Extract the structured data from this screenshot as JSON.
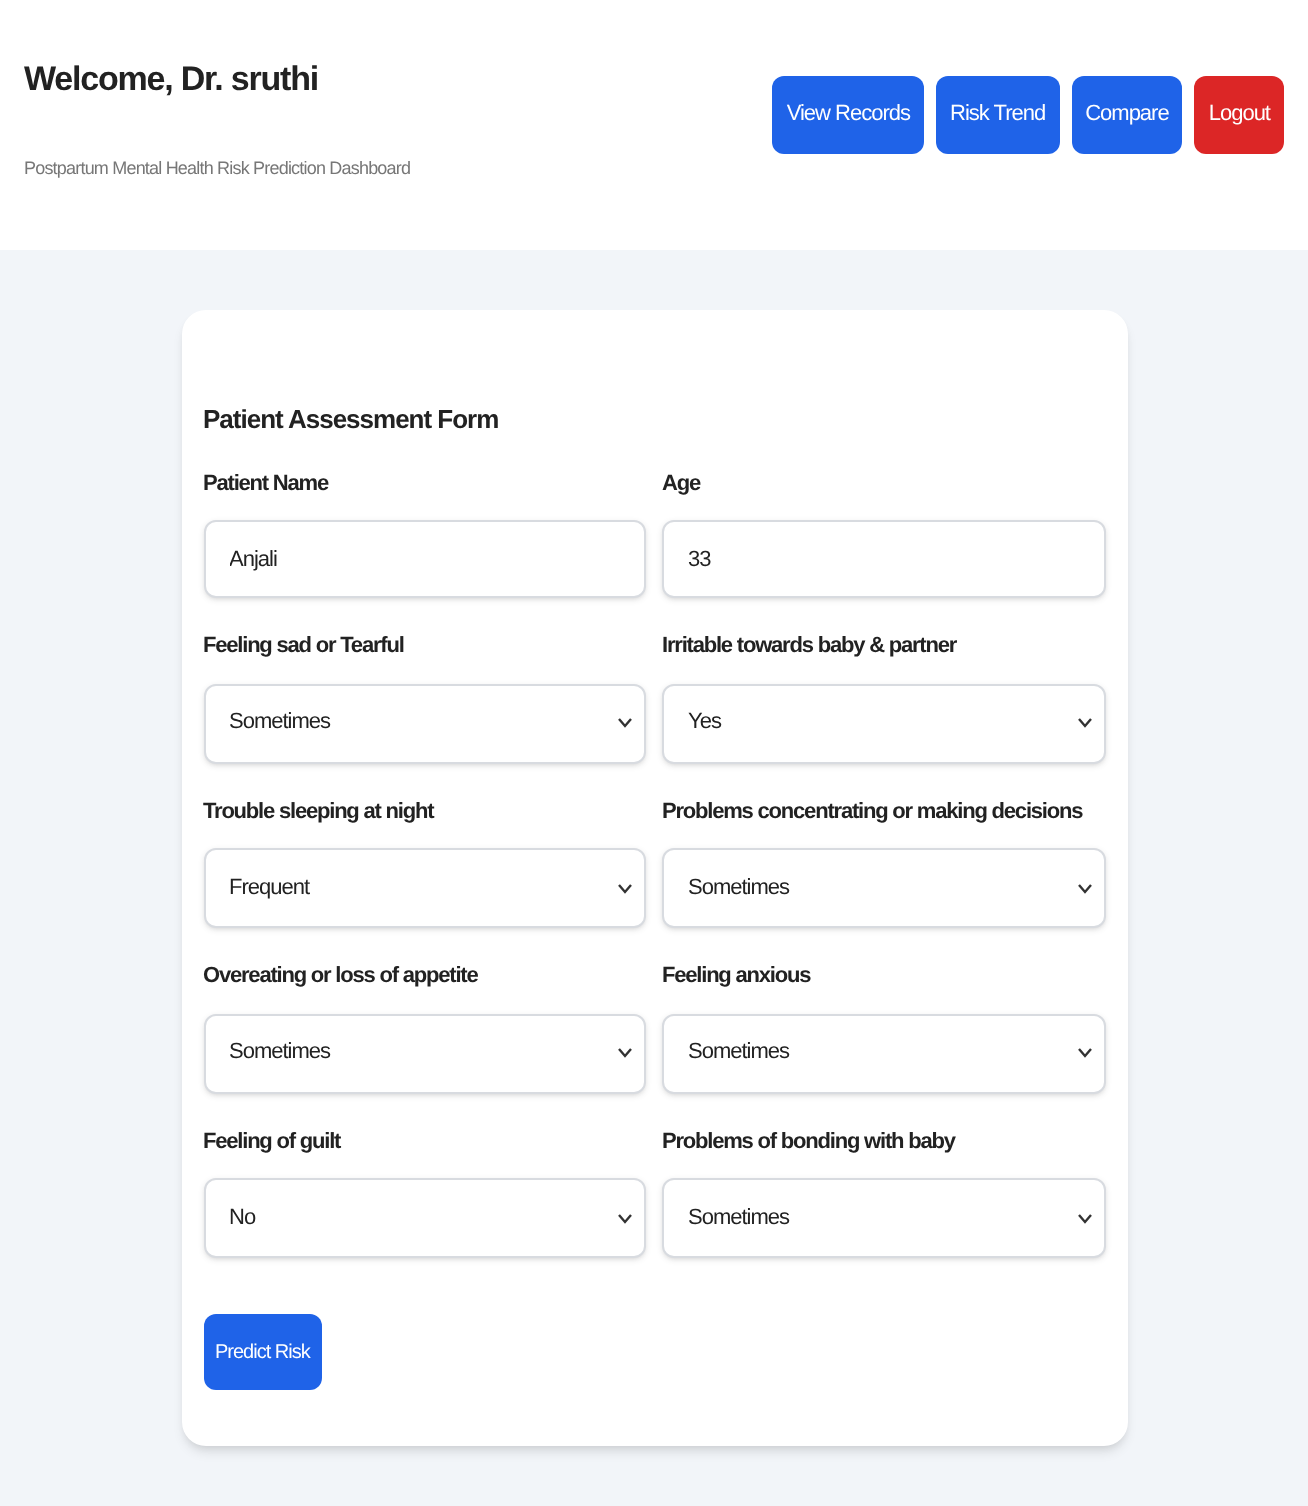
{
  "header": {
    "title": "Welcome, Dr. sruthi",
    "subtitle": "Postpartum Mental Health Risk Prediction Dashboard",
    "buttons": [
      {
        "label": "View Records",
        "kind": "primary"
      },
      {
        "label": "Risk Trend",
        "kind": "primary"
      },
      {
        "label": "Compare",
        "kind": "primary"
      },
      {
        "label": "Logout",
        "kind": "danger"
      }
    ]
  },
  "form": {
    "title": "Patient Assessment Form",
    "fields": [
      {
        "label": "Patient Name",
        "kind": "text",
        "value": "Anjali"
      },
      {
        "label": "Age",
        "kind": "text",
        "value": "33"
      },
      {
        "label": "Feeling sad or Tearful",
        "kind": "select",
        "value": "Sometimes"
      },
      {
        "label": "Irritable towards baby & partner",
        "kind": "select",
        "value": "Yes"
      },
      {
        "label": "Trouble sleeping at night",
        "kind": "select",
        "value": "Frequent"
      },
      {
        "label": "Problems concentrating or making decisions",
        "kind": "select",
        "value": "Sometimes"
      },
      {
        "label": "Overeating or loss of appetite",
        "kind": "select",
        "value": "Sometimes"
      },
      {
        "label": "Feeling anxious",
        "kind": "select",
        "value": "Sometimes"
      },
      {
        "label": "Feeling of guilt",
        "kind": "select",
        "value": "No"
      },
      {
        "label": "Problems of bonding with baby",
        "kind": "select",
        "value": "Sometimes"
      }
    ],
    "submit": "Predict Risk"
  }
}
